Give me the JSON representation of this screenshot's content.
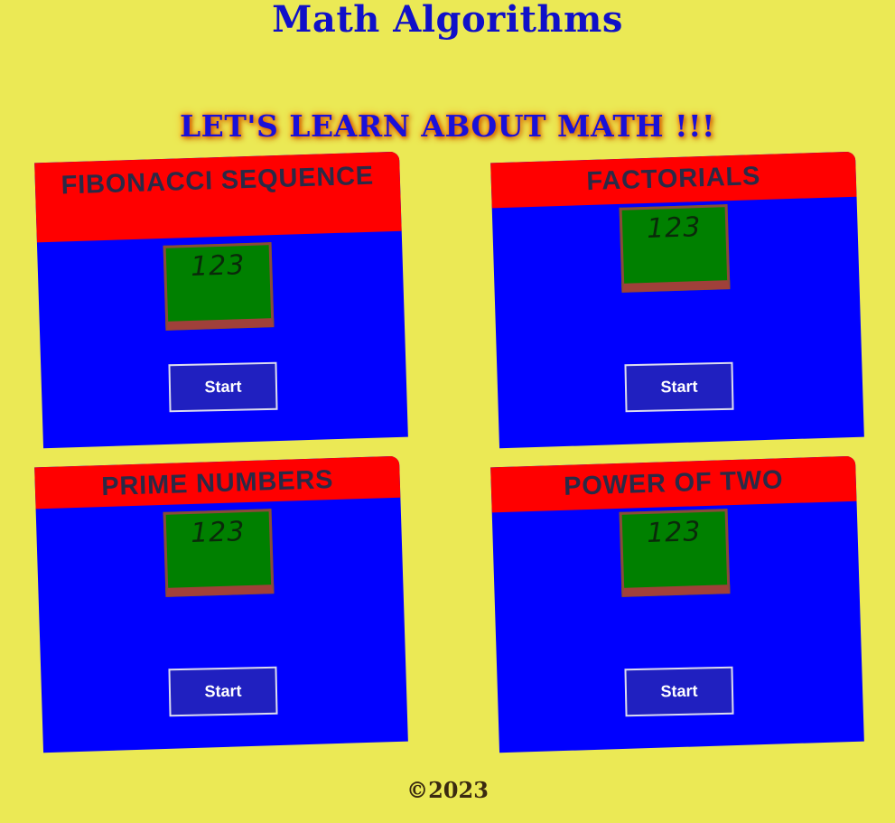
{
  "header": {
    "title": "Math Algorithms",
    "tagline": "LET'S LEARN ABOUT MATH !!!"
  },
  "cards": [
    {
      "title": "FIBONACCI SEQUENCE",
      "chalkboard_text": "123",
      "button_label": "Start"
    },
    {
      "title": "FACTORIALS",
      "chalkboard_text": "123",
      "button_label": "Start"
    },
    {
      "title": "PRIME NUMBERS",
      "chalkboard_text": "123",
      "button_label": "Start"
    },
    {
      "title": "POWER OF TWO",
      "chalkboard_text": "123",
      "button_label": "Start"
    }
  ],
  "footer": {
    "copyright": "©2023"
  },
  "colors": {
    "background": "#ebe955",
    "title": "#1010c8",
    "card_body": "#0000ff",
    "card_header": "#ff0000",
    "chalkboard": "#008000",
    "chalkboard_frame": "#a0403a",
    "button": "#2020c0"
  }
}
